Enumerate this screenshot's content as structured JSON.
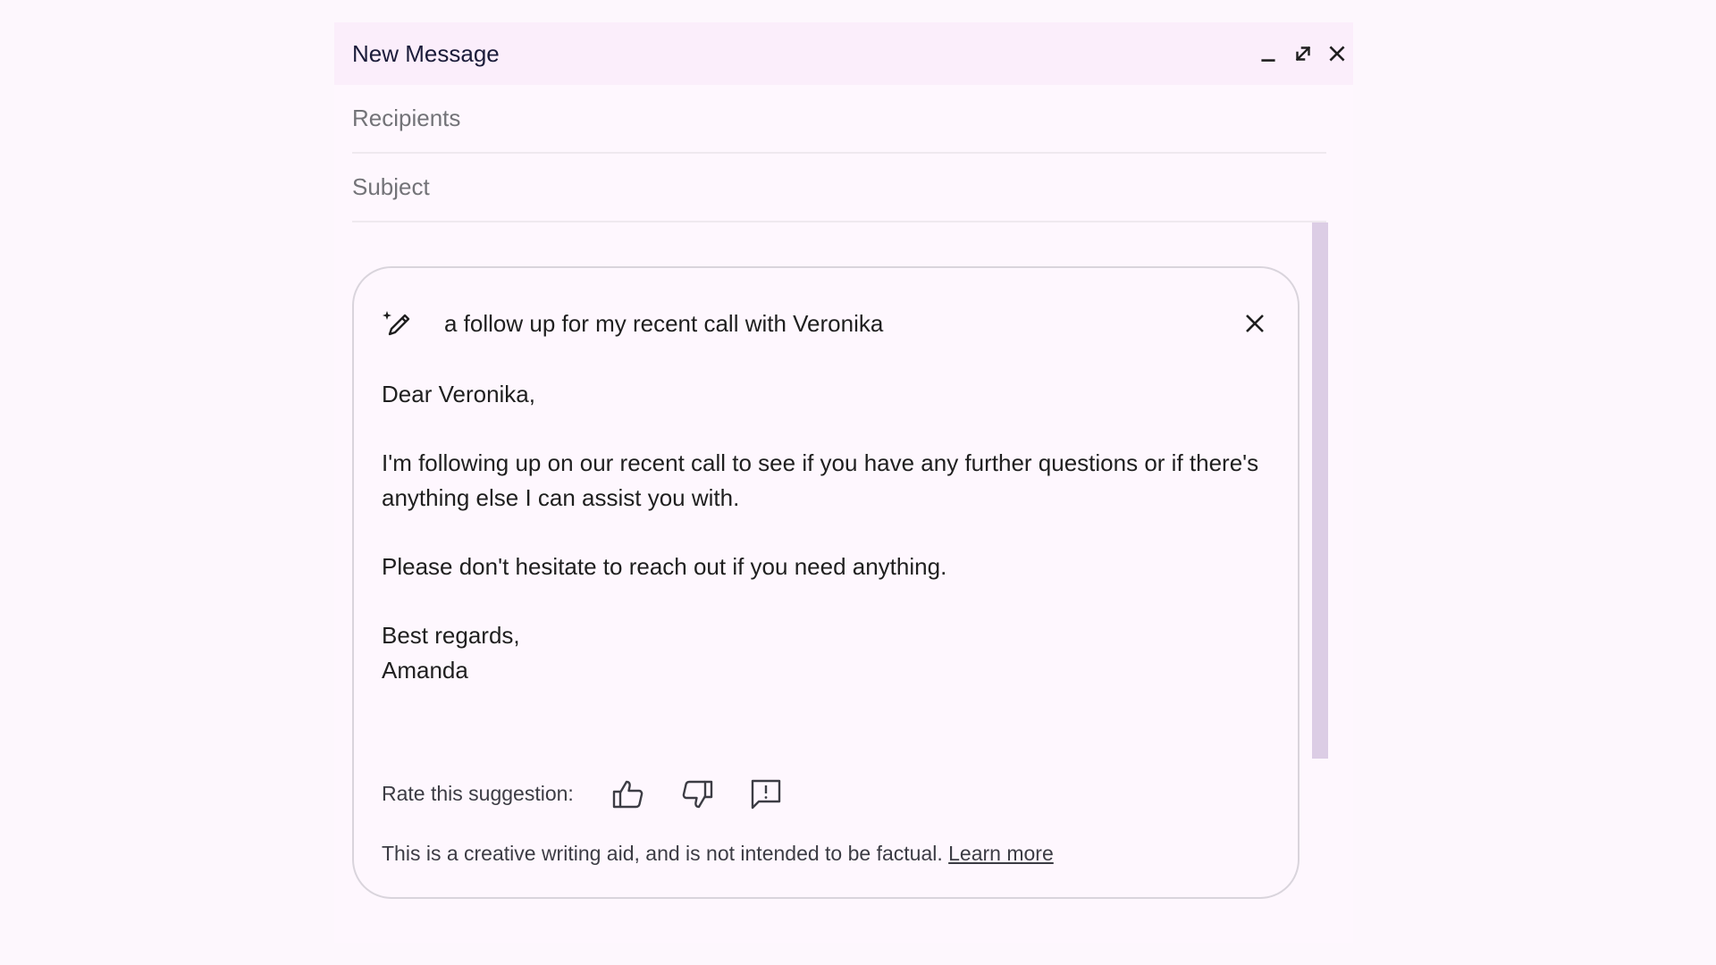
{
  "window": {
    "title": "New Message",
    "minimize_icon": "minimize-icon",
    "expand_icon": "expand-icon",
    "close_icon": "close-icon"
  },
  "fields": {
    "recipients_placeholder": "Recipients",
    "subject_placeholder": "Subject"
  },
  "suggestion": {
    "prompt_icon": "magic-pen-icon",
    "prompt": "a follow up for my recent call with Veronika",
    "close_icon": "close-icon",
    "body": {
      "greeting": "Dear Veronika,",
      "paragraph1": "I'm following up on our recent call to see if you have any further questions or if there's anything else I can assist you with.",
      "paragraph2": "Please don't hesitate to reach out if you need anything.",
      "closing": "Best regards,",
      "signature": "Amanda"
    },
    "rate_label": "Rate this suggestion:",
    "rate_icons": [
      "thumbs-up-icon",
      "thumbs-down-icon",
      "report-feedback-icon"
    ],
    "disclaimer": "This is a creative writing aid, and is not intended to be factual.",
    "learn_more": "Learn more"
  },
  "colors": {
    "background": "#fdf7fd",
    "titlebar": "#fbeefb",
    "card_border": "#d9d4dc",
    "scrollbar": "#dccde5"
  }
}
